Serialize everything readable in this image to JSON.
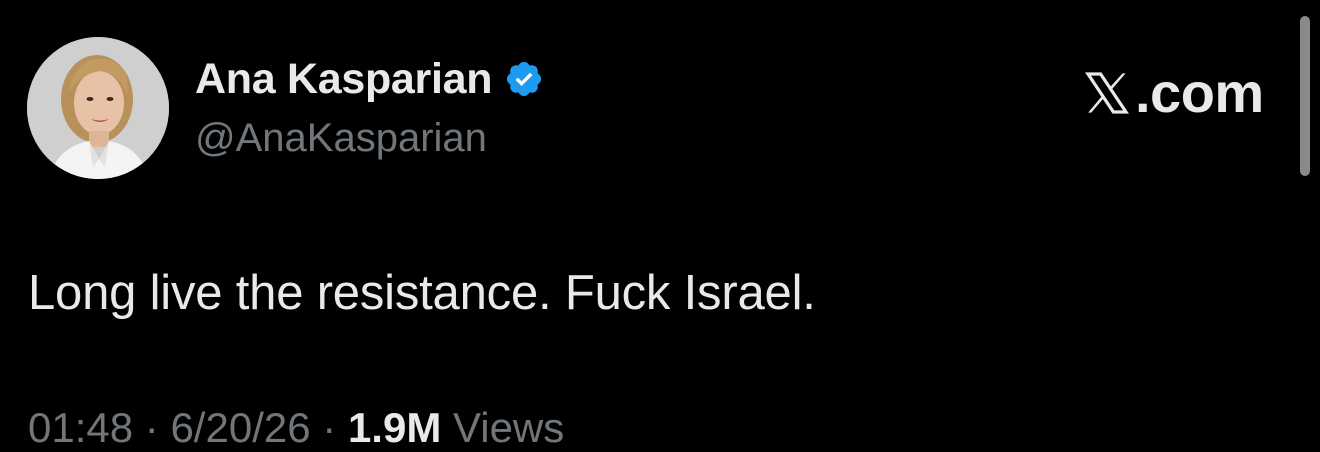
{
  "author": {
    "display_name": "Ana Kasparian",
    "handle": "@AnaKasparian",
    "verified": true,
    "verified_badge_icon": "verified-badge-icon"
  },
  "brand": {
    "text": ".com",
    "logo_icon": "x-logo-icon"
  },
  "tweet": {
    "text": "Long live the resistance. Fuck Israel."
  },
  "meta": {
    "time": "01:48",
    "separator": "·",
    "date": "6/20/26",
    "views_count": "1.9M",
    "views_label": "Views"
  },
  "colors": {
    "background": "#000000",
    "primary_text": "#e7e9ea",
    "secondary_text": "#71767b",
    "verified_blue": "#1d9bf0"
  }
}
